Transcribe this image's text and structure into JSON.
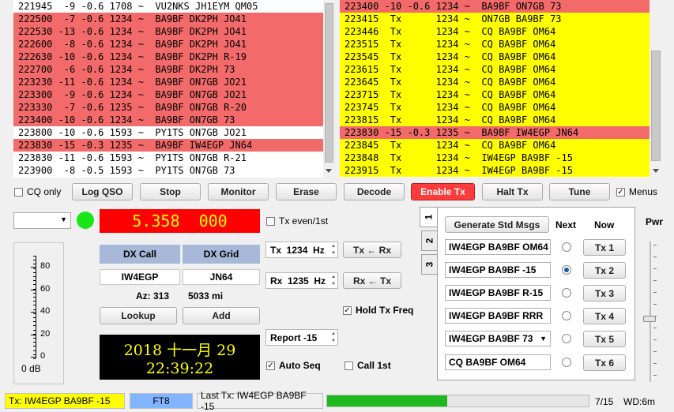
{
  "band_activity": {
    "rows": [
      {
        "text": "221945  -9 -0.6 1708 ~  VU2NKS JH1EYM QM05",
        "style": "white"
      },
      {
        "text": "222500  -7 -0.6 1234 ~  BA9BF DK2PH JO41",
        "style": "red"
      },
      {
        "text": "222530 -13 -0.6 1234 ~  BA9BF DK2PH JO41",
        "style": "red"
      },
      {
        "text": "222600  -8 -0.6 1234 ~  BA9BF DK2PH JO41",
        "style": "red"
      },
      {
        "text": "222630 -10 -0.6 1234 ~  BA9BF DK2PH R-19",
        "style": "red"
      },
      {
        "text": "222700  -6 -0.6 1234 ~  BA9BF DK2PH 73",
        "style": "red"
      },
      {
        "text": "223230 -11 -0.6 1234 ~  BA9BF ON7GB JO21",
        "style": "red"
      },
      {
        "text": "223300  -9 -0.6 1234 ~  BA9BF ON7GB JO21",
        "style": "red"
      },
      {
        "text": "223330  -7 -0.6 1235 ~  BA9BF ON7GB R-20",
        "style": "red"
      },
      {
        "text": "223400 -10 -0.6 1234 ~  BA9BF ON7GB 73",
        "style": "red"
      },
      {
        "text": "223800 -10 -0.6 1593 ~  PY1TS ON7GB JO21",
        "style": "white"
      },
      {
        "text": "223830 -15 -0.3 1235 ~  BA9BF IW4EGP JN64",
        "style": "red"
      },
      {
        "text": "223830 -11 -0.6 1593 ~  PY1TS ON7GB R-21",
        "style": "white"
      },
      {
        "text": "223900  -8 -0.5 1593 ~  PY1TS ON7GB 73",
        "style": "white"
      }
    ]
  },
  "rx_frequency": {
    "rows": [
      {
        "text": "223400 -10 -0.6 1234 ~  BA9BF ON7GB 73",
        "style": "red"
      },
      {
        "text": "223415  Tx      1234 ~  ON7GB BA9BF 73",
        "style": "yellow"
      },
      {
        "text": "223446  Tx      1234 ~  CQ BA9BF OM64",
        "style": "yellow"
      },
      {
        "text": "223515  Tx      1234 ~  CQ BA9BF OM64",
        "style": "yellow"
      },
      {
        "text": "223545  Tx      1234 ~  CQ BA9BF OM64",
        "style": "yellow"
      },
      {
        "text": "223615  Tx      1234 ~  CQ BA9BF OM64",
        "style": "yellow"
      },
      {
        "text": "223645  Tx      1234 ~  CQ BA9BF OM64",
        "style": "yellow"
      },
      {
        "text": "223715  Tx      1234 ~  CQ BA9BF OM64",
        "style": "yellow"
      },
      {
        "text": "223745  Tx      1234 ~  CQ BA9BF OM64",
        "style": "yellow"
      },
      {
        "text": "223815  Tx      1234 ~  CQ BA9BF OM64",
        "style": "yellow"
      },
      {
        "text": "223830 -15 -0.3 1235 ~  BA9BF IW4EGP JN64",
        "style": "red"
      },
      {
        "text": "223845  Tx      1234 ~  CQ BA9BF OM64",
        "style": "yellow"
      },
      {
        "text": "223848  Tx      1234 ~  IW4EGP BA9BF -15",
        "style": "yellow"
      },
      {
        "text": "223915  Tx      1234 ~  IW4EGP BA9BF -15",
        "style": "yellow"
      }
    ]
  },
  "controls": {
    "cq_only": "CQ only",
    "log_qso": "Log QSO",
    "stop": "Stop",
    "monitor": "Monitor",
    "erase": "Erase",
    "decode": "Decode",
    "enable_tx": "Enable Tx",
    "halt_tx": "Halt Tx",
    "tune": "Tune",
    "menus": "Menus"
  },
  "frequency": "5.358  000",
  "tx_even": "Tx even/1st",
  "dx": {
    "call_label": "DX Call",
    "grid_label": "DX Grid",
    "call": "IW4EGP",
    "grid": "JN64",
    "az": "Az: 313",
    "dist": "5033 mi",
    "lookup": "Lookup",
    "add": "Add"
  },
  "tx_freq": "Tx  1234  Hz",
  "rx_freq": "Rx  1235  Hz",
  "tx_from_rx": "Tx ← Rx",
  "rx_from_tx": "Rx ← Tx",
  "hold_tx_freq": "Hold Tx Freq",
  "report": "Report -15",
  "auto_seq": "Auto Seq",
  "call_1st": "Call 1st",
  "meter": {
    "ticks": [
      "80",
      "60",
      "40",
      "20",
      "0"
    ],
    "db": "0 dB",
    "level_fraction": 0
  },
  "clock": {
    "date": "2018 十一月 29",
    "time": "22:39:22"
  },
  "messages": {
    "tabs": [
      "1",
      "2",
      "3"
    ],
    "generate": "Generate Std Msgs",
    "next": "Next",
    "now": "Now",
    "items": [
      {
        "text": "IW4EGP BA9BF OM64",
        "btn": "Tx 1",
        "next": false
      },
      {
        "text": "IW4EGP BA9BF -15",
        "btn": "Tx 2",
        "next": true
      },
      {
        "text": "IW4EGP BA9BF R-15",
        "btn": "Tx 3",
        "next": false
      },
      {
        "text": "IW4EGP BA9BF RRR",
        "btn": "Tx 4",
        "next": false
      },
      {
        "text": "IW4EGP BA9BF 73",
        "btn": "Tx 5",
        "next": false
      },
      {
        "text": "CQ BA9BF OM64",
        "btn": "Tx 6",
        "next": false
      }
    ]
  },
  "pwr": "Pwr",
  "status": {
    "tx": "Tx: IW4EGP BA9BF -15",
    "mode": "FT8",
    "last_tx": "Last Tx: IW4EGP BA9BF -15",
    "progress_fraction": 0.46,
    "progress_text": "7/15",
    "wd": "WD:6m"
  },
  "colors": {
    "red": "#f26a6a",
    "yellow": "#ffff00",
    "freq_bg": "#ff0000",
    "dx_label_bg": "#a8b8d8",
    "enable_tx": "#ff3b3b",
    "mode_bg": "#82b4ff",
    "progress": "#1fb81f"
  }
}
